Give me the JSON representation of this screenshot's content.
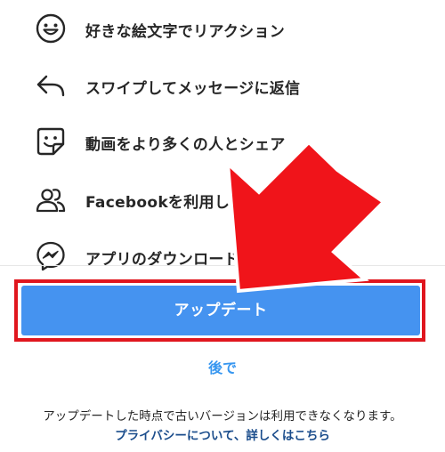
{
  "features": [
    {
      "icon": "smile-emoji-icon",
      "label": "好きな絵文字でリアクション"
    },
    {
      "icon": "reply-arrow-icon",
      "label": "スワイプしてメッセージに返信"
    },
    {
      "icon": "sticker-icon",
      "label": "動画をより多くの人とシェア"
    },
    {
      "icon": "people-icon",
      "label": "Facebookを利用しているチャット"
    },
    {
      "icon": "messenger-icon",
      "label": "アプリのダウンロードはありません"
    }
  ],
  "update_button": {
    "label": "アップデート"
  },
  "later_link": {
    "label": "後で"
  },
  "notice": "アップデートした時点で古いバージョンは利用できなくなります。",
  "privacy_link": "プライバシーについて、詳しくはこちら",
  "colors": {
    "button": "#4593f0",
    "link": "#3897f0",
    "highlight": "#e0161e",
    "arrow": "#f0141a"
  }
}
